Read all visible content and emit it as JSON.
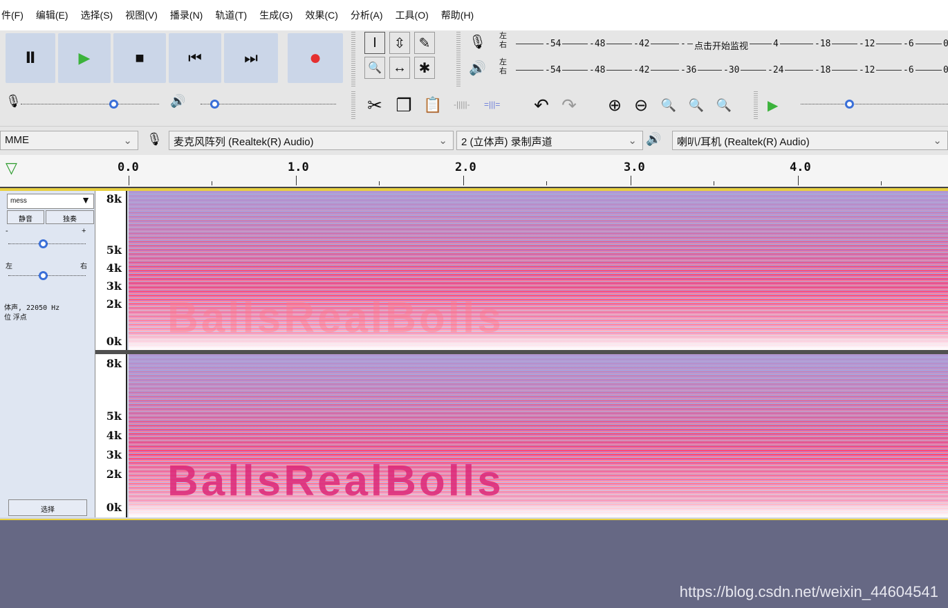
{
  "menu": [
    "件(F)",
    "编辑(E)",
    "选择(S)",
    "视图(V)",
    "播录(N)",
    "轨道(T)",
    "生成(G)",
    "效果(C)",
    "分析(A)",
    "工具(O)",
    "帮助(H)"
  ],
  "transport": {
    "pause_icon": "Ⅱ",
    "play_icon": "▶",
    "stop_icon": "■",
    "skip_start_icon": "⏮",
    "skip_end_icon": "⏭",
    "record_icon": "●"
  },
  "tools": {
    "select": "I",
    "envelope": "⇳",
    "draw": "✎",
    "zoom": "🔍",
    "timeshift": "↔",
    "multi": "✱"
  },
  "meters": {
    "record_lr": [
      "左",
      "右"
    ],
    "play_lr": [
      "左",
      "右"
    ],
    "record_ticks": [
      "-54",
      "-48",
      "-42",
      "-",
      "4",
      "-18",
      "-12",
      "-6",
      "0"
    ],
    "record_monitor_text": "点击开始监视",
    "play_ticks": [
      "-54",
      "-48",
      "-42",
      "-36",
      "-30",
      "-24",
      "-18",
      "-12",
      "-6",
      "0"
    ]
  },
  "edit": {
    "cut": "✂",
    "copy": "❐",
    "paste": "📋",
    "undo": "↶",
    "redo": "↷"
  },
  "zoom": {
    "zoom_in": "⊕",
    "zoom_out": "⊖"
  },
  "devices": {
    "host": "MME",
    "mic": "麦克风阵列 (Realtek(R) Audio)",
    "channels": "2 (立体声) 录制声道",
    "speaker": "喇叭/耳机 (Realtek(R) Audio)"
  },
  "ruler": {
    "labels": [
      "0.0",
      "1.0",
      "2.0",
      "3.0",
      "4.0"
    ]
  },
  "track": {
    "name": "mess",
    "mute": "静音",
    "solo": "独奏",
    "gain_plus": "+",
    "gain_minus": "-",
    "pan_left": "左",
    "pan_right": "右",
    "info1": "体声, 22050 Hz",
    "info2": "位 浮点",
    "select_btn": "选择",
    "scale": [
      "8k",
      "5k",
      "4k",
      "3k",
      "2k",
      "0k"
    ],
    "watermark_text": "BallsRealBolls"
  },
  "status": {
    "watermark": "https://blog.csdn.net/weixin_44604541"
  }
}
